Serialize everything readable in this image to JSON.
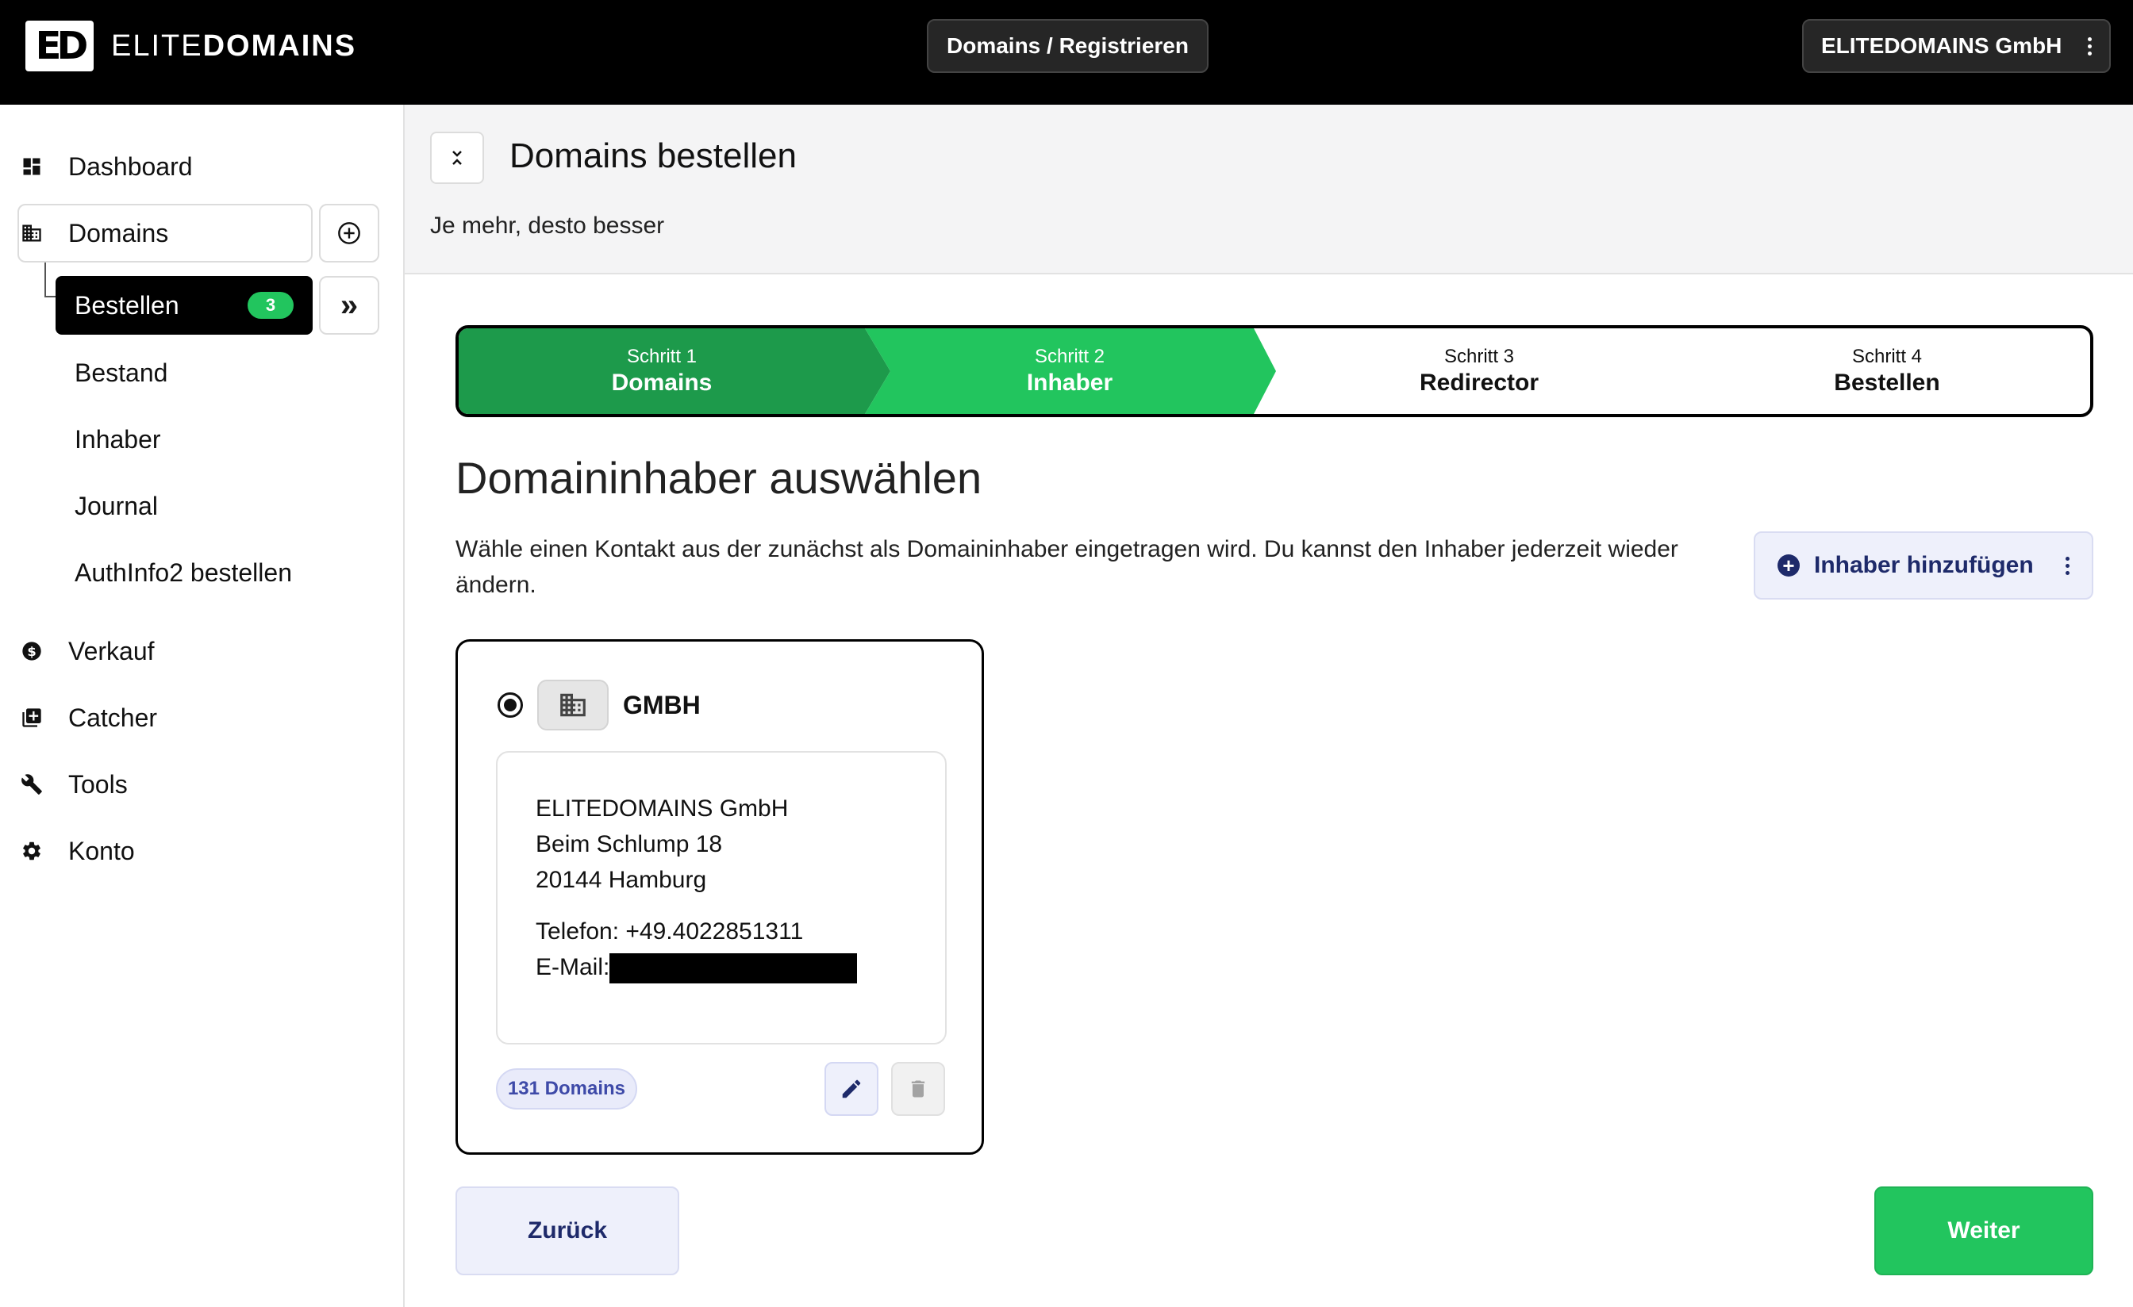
{
  "header": {
    "logo_mark": "ED",
    "logo_text_light": "ELITE",
    "logo_text_bold": "DOMAINS",
    "center_nav": "Domains / Registrieren",
    "account": "ELITEDOMAINS GmbH"
  },
  "sidebar": {
    "items": [
      {
        "label": "Dashboard",
        "icon": "dashboard-icon"
      },
      {
        "label": "Domains",
        "icon": "building-icon"
      },
      {
        "label": "Verkauf",
        "icon": "dollar-circle-icon"
      },
      {
        "label": "Catcher",
        "icon": "library-add-icon"
      },
      {
        "label": "Tools",
        "icon": "wrench-icon"
      },
      {
        "label": "Konto",
        "icon": "gear-icon"
      }
    ],
    "sub_items": [
      {
        "label": "Bestellen",
        "badge": "3",
        "active": true
      },
      {
        "label": "Bestand"
      },
      {
        "label": "Inhaber"
      },
      {
        "label": "Journal"
      },
      {
        "label": "AuthInfo2 bestellen"
      }
    ]
  },
  "page": {
    "title": "Domains bestellen",
    "subtitle": "Je mehr, desto besser"
  },
  "stepper": {
    "steps": [
      {
        "number": "Schritt 1",
        "name": "Domains",
        "state": "done"
      },
      {
        "number": "Schritt 2",
        "name": "Inhaber",
        "state": "active"
      },
      {
        "number": "Schritt 3",
        "name": "Redirector",
        "state": "pending"
      },
      {
        "number": "Schritt 4",
        "name": "Bestellen",
        "state": "pending"
      }
    ]
  },
  "section": {
    "title": "Domaininhaber auswählen",
    "description": "Wähle einen Kontakt aus der zunächst als Domaininhaber eingetragen wird. Du kannst den Inhaber jederzeit wieder ändern.",
    "add_owner_label": "Inhaber hinzufügen"
  },
  "contact": {
    "type": "GMBH",
    "company": "ELITEDOMAINS GmbH",
    "street": "Beim Schlump 18",
    "city": "20144 Hamburg",
    "phone": "Telefon: +49.4022851311",
    "email_label": "E-Mail:",
    "domains_count": "131 Domains",
    "selected": true
  },
  "actions": {
    "back": "Zurück",
    "next": "Weiter"
  },
  "colors": {
    "step_done": "#1d9a4b",
    "step_active": "#22c55e",
    "accent_indigo": "#1e2a6a",
    "primary_green": "#22c55e"
  }
}
